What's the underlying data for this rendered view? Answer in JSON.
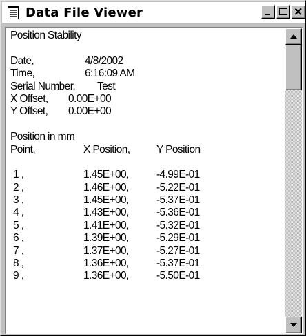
{
  "window": {
    "title": "Data File Viewer",
    "icon": "document-icon",
    "buttons": [
      "minimize",
      "maximize",
      "close"
    ]
  },
  "file": {
    "heading": "Position Stability",
    "date_label": "Date,",
    "date_value": "4/8/2002",
    "time_label": "Time,",
    "time_value": "6:16:09 AM",
    "serial_label": "Serial Number,",
    "serial_value": "Test",
    "x_offset_label": "X Offset,",
    "x_offset_value": "0.00E+00",
    "y_offset_label": "Y Offset,",
    "y_offset_value": "0.00E+00",
    "units_line": "Position in mm",
    "columns": [
      "Point,",
      "X Position,",
      "Y Position"
    ],
    "rows": [
      {
        "point": "1 ,",
        "x": "1.45E+00,",
        "y": "-4.99E-01"
      },
      {
        "point": "2 ,",
        "x": "1.46E+00,",
        "y": "-5.22E-01"
      },
      {
        "point": "3 ,",
        "x": "1.45E+00,",
        "y": "-5.37E-01"
      },
      {
        "point": "4 ,",
        "x": "1.43E+00,",
        "y": "-5.36E-01"
      },
      {
        "point": "5 ,",
        "x": "1.41E+00,",
        "y": "-5.32E-01"
      },
      {
        "point": "6 ,",
        "x": "1.39E+00,",
        "y": "-5.29E-01"
      },
      {
        "point": "7 ,",
        "x": "1.37E+00,",
        "y": "-5.27E-01"
      },
      {
        "point": "8 ,",
        "x": "1.36E+00,",
        "y": "-5.37E-01"
      },
      {
        "point": "9 ,",
        "x": "1.36E+00,",
        "y": "-5.50E-01"
      }
    ]
  },
  "scrollbar": {
    "position_fraction": 0
  },
  "colors": {
    "window_face": "#c0c0c0",
    "title_bg": "#ffffff",
    "text": "#000000",
    "content_bg": "#ffffff"
  }
}
